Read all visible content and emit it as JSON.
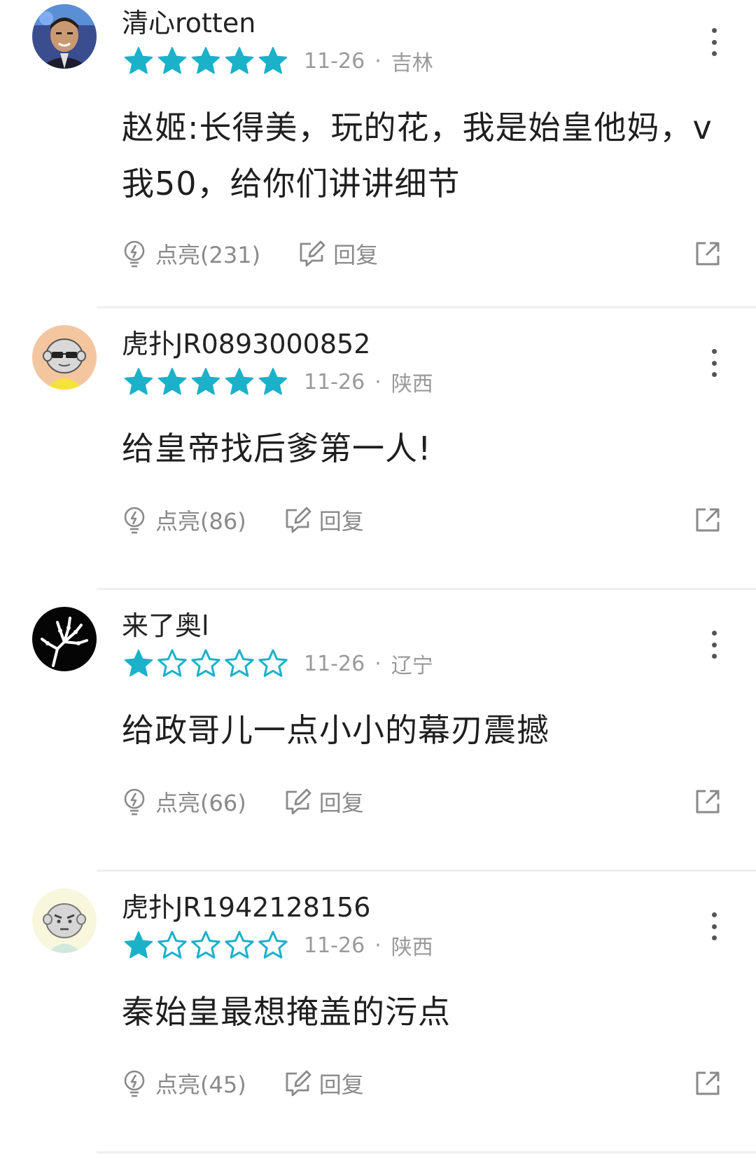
{
  "comments": [
    {
      "username": "清心rotten",
      "rating": 5,
      "date": "11-26",
      "separator": "·",
      "region": "吉林",
      "avatar": "person-photo",
      "content_lines": [
        "赵姬:长得美，玩的花，我是始皇他妈，v",
        "我50，给你们讲讲细节"
      ],
      "like_label": "点亮(231)",
      "reply_label": "回复"
    },
    {
      "username": "虎扑JR0893000852",
      "rating": 5,
      "date": "11-26",
      "separator": "·",
      "region": "陕西",
      "avatar": "cartoon-sunglasses",
      "content_lines": [
        "给皇帝找后爹第一人!"
      ],
      "like_label": "点亮(86)",
      "reply_label": "回复"
    },
    {
      "username": "来了奥l",
      "rating": 1,
      "date": "11-26",
      "separator": "·",
      "region": "辽宁",
      "avatar": "skeleton-hand",
      "content_lines": [
        "给政哥儿一点小小的幕刃震撼"
      ],
      "like_label": "点亮(66)",
      "reply_label": "回复"
    },
    {
      "username": "虎扑JR1942128156",
      "rating": 1,
      "date": "11-26",
      "separator": "·",
      "region": "陕西",
      "avatar": "cartoon-angry",
      "content_lines": [
        "秦始皇最想掩盖的污点"
      ],
      "like_label": "点亮(45)",
      "reply_label": "回复"
    }
  ],
  "icons": {
    "star_filled": "star-filled-icon",
    "star_outline": "star-outline-icon",
    "like": "lightbulb-icon",
    "reply": "edit-icon",
    "share": "share-icon",
    "more": "more-vertical-icon"
  },
  "colors": {
    "star": "#1bb1c9",
    "meta_text": "#9a9a9a",
    "action_text": "#8a8a8a",
    "divider": "#eeeeee",
    "content_text": "#1f1f1f"
  }
}
